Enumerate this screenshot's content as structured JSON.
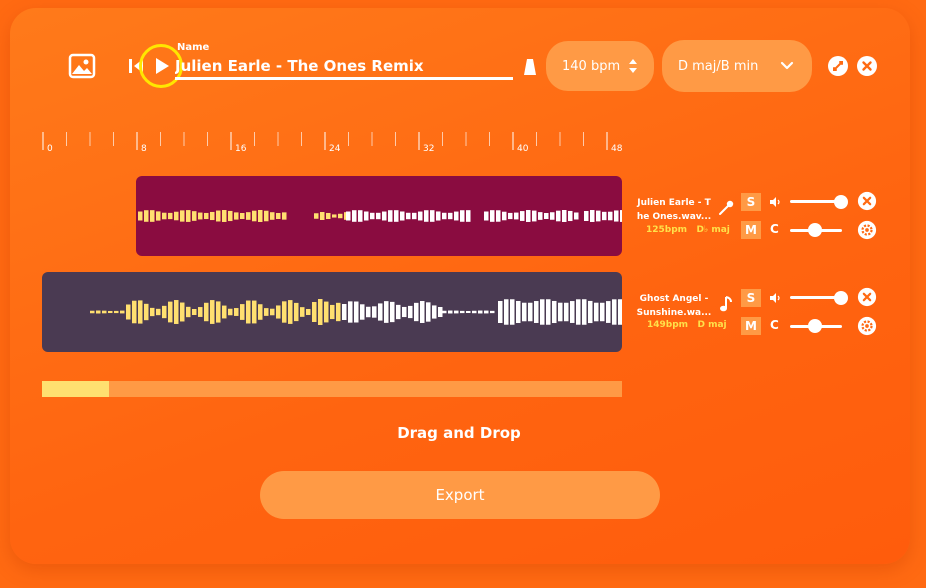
{
  "header": {
    "name_label": "Name",
    "name_value": "Julien Earle - The Ones Remix",
    "bpm_label": "140 bpm",
    "key_label": "D maj/B min"
  },
  "ruler": {
    "labels": [
      "0",
      "8",
      "16",
      "24",
      "32",
      "40",
      "48"
    ]
  },
  "tracks": [
    {
      "name": "Julien Earle - The Ones.wav...",
      "name_line1": "Julien Earle - T",
      "name_line2": "he Ones.wav...",
      "bpm": "125bpm",
      "key": "D♭ maj",
      "solo": "S",
      "mute": "M",
      "c": "C",
      "volume": 1.0,
      "pitch": 0.5,
      "type_icon": "microphone-icon",
      "color": "#8a0c40"
    },
    {
      "name": "Ghost Angel - Sunshine.wav...",
      "name_line1": "Ghost Angel -",
      "name_line2": "Sunshine.wa...",
      "bpm": "149bpm",
      "key": "D maj",
      "solo": "S",
      "mute": "M",
      "c": "C",
      "volume": 1.0,
      "pitch": 0.5,
      "type_icon": "music-note-icon",
      "color": "#4a3a52"
    }
  ],
  "progress": 0.115,
  "drag_drop_label": "Drag and Drop",
  "export_label": "Export",
  "colors": {
    "background": "#ff6a12",
    "accent": "#ff9a45",
    "highlight": "#ffe070",
    "play_focus_ring": "#ffe600"
  }
}
